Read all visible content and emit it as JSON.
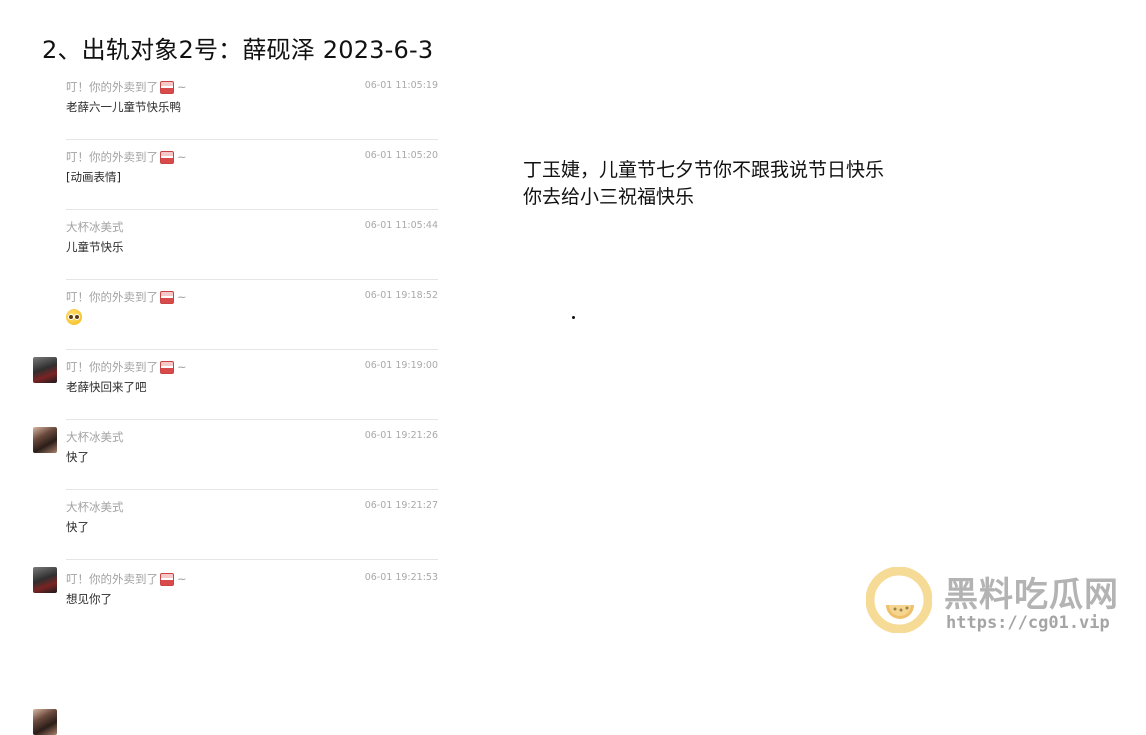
{
  "slide": {
    "title": "2、出轨对象2号：薛砚泽 2023-6-3"
  },
  "chat": {
    "messages": [
      {
        "avatar": "none",
        "sender": "叮！你的外卖到了",
        "sender_suffix": "~",
        "time": "06-01 11:05:19",
        "content": "老薛六一儿童节快乐鸭"
      },
      {
        "avatar": "none",
        "sender": "叮！你的外卖到了",
        "sender_suffix": "~",
        "time": "06-01 11:05:20",
        "content": "[动画表情]"
      },
      {
        "avatar": "dark",
        "sender": "大杯冰美式",
        "sender_suffix": "",
        "time": "06-01 11:05:44",
        "content": "儿童节快乐"
      },
      {
        "avatar": "girl",
        "sender": "叮！你的外卖到了",
        "sender_suffix": "~",
        "time": "06-01 19:18:52",
        "content": "",
        "content_icon": "pleading-face-emoji"
      },
      {
        "avatar": "none",
        "sender": "叮！你的外卖到了",
        "sender_suffix": "~",
        "time": "06-01 19:19:00",
        "content": "老薛快回来了吧"
      },
      {
        "avatar": "dark",
        "sender": "大杯冰美式",
        "sender_suffix": "",
        "time": "06-01 19:21:26",
        "content": "快了"
      },
      {
        "avatar": "none",
        "sender": "大杯冰美式",
        "sender_suffix": "",
        "time": "06-01 19:21:27",
        "content": "快了"
      },
      {
        "avatar": "girl",
        "sender": "叮！你的外卖到了",
        "sender_suffix": "~",
        "time": "06-01 19:21:53",
        "content": "想见你了"
      }
    ]
  },
  "caption": {
    "line1": "丁玉婕，儿童节七夕节你不跟我说节日快乐",
    "line2": "你去给小三祝福快乐"
  },
  "watermark": {
    "title": "黑料吃瓜网",
    "url": "https://cg01.vip",
    "colors": {
      "logo_ring": "#f3d27a",
      "logo_inner": "#e9a93a",
      "text": "#9a9a9a"
    }
  }
}
